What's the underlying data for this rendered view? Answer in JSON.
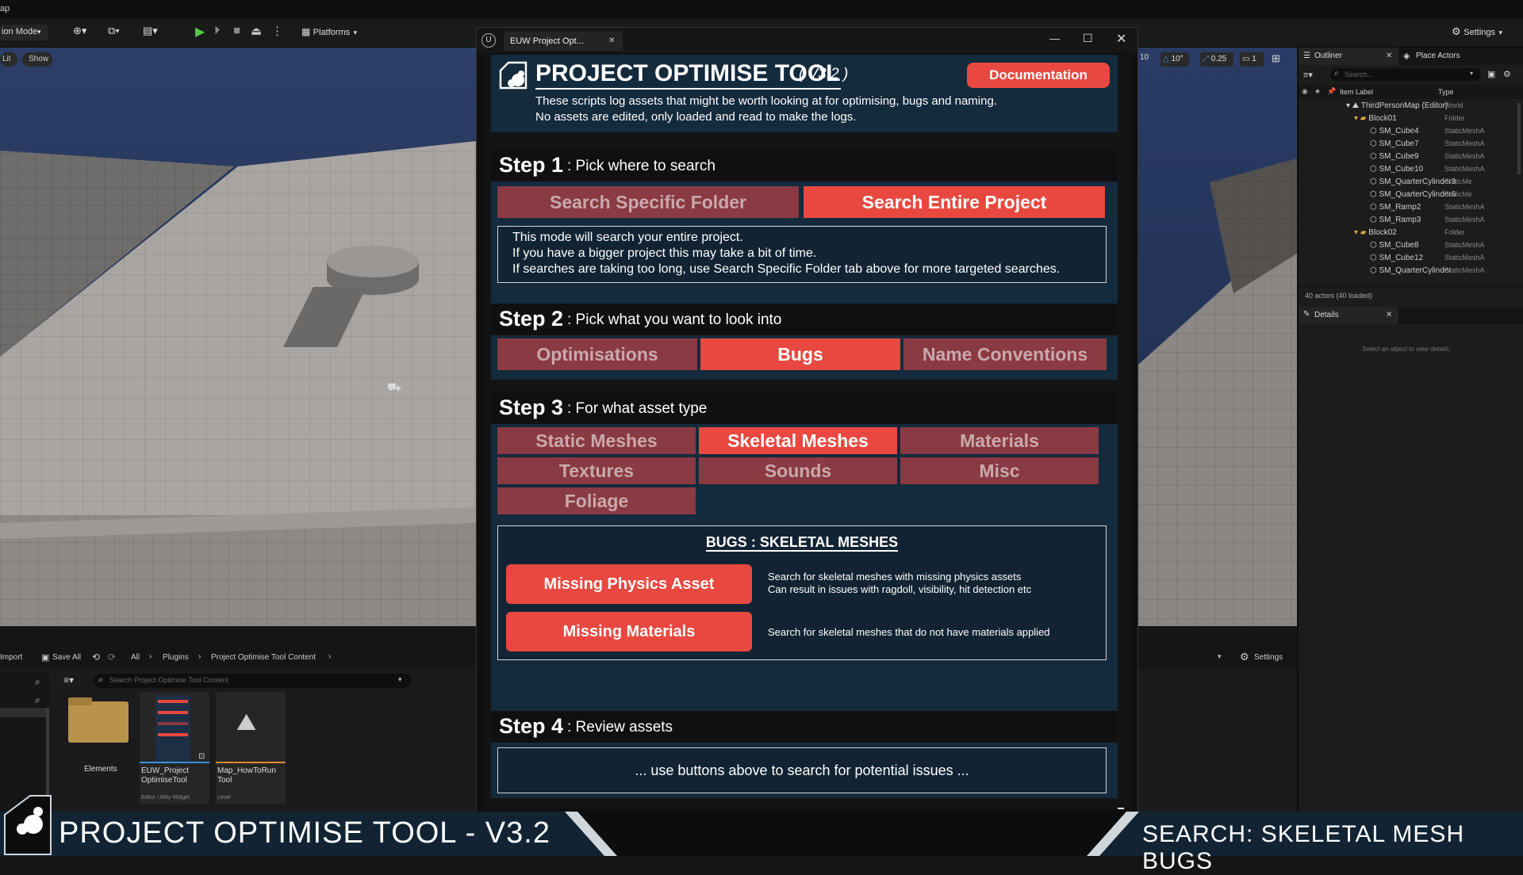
{
  "editor": {
    "top_partial": "ap",
    "mode_label": "ion Mode",
    "platforms_label": "Platforms",
    "settings_label": "Settings",
    "viewport": {
      "lit_label": "Lit",
      "show_label": "Show",
      "snap_values": [
        "10",
        "10°",
        "0.25",
        "1"
      ]
    },
    "content_browser": {
      "import_label": "Import",
      "save_all_label": "Save All",
      "crumbs": [
        "All",
        "Plugins",
        "Project Optimise Tool Content"
      ],
      "search_placeholder": "Search Project Optimise Tool Content",
      "settings_label": "Settings",
      "assets": [
        {
          "name": "Elements",
          "type": ""
        },
        {
          "name": "EUW_Project OptimiseTool",
          "type": "Editor Utility Widget"
        },
        {
          "name": "Map_HowToRun Tool",
          "type": "Level"
        }
      ]
    },
    "outliner": {
      "tab_outliner": "Outliner",
      "tab_place": "Place Actors",
      "search_placeholder": "Search...",
      "col_label": "Item Label",
      "col_type": "Type",
      "rows": [
        {
          "label": "ThirdPersonMap (Editor)",
          "type": "World"
        },
        {
          "label": "Block01",
          "type": "Folder"
        },
        {
          "label": "SM_Cube4",
          "type": "StaticMeshA"
        },
        {
          "label": "SM_Cube7",
          "type": "StaticMeshA"
        },
        {
          "label": "SM_Cube9",
          "type": "StaticMeshA"
        },
        {
          "label": "SM_Cube10",
          "type": "StaticMeshA"
        },
        {
          "label": "SM_QuarterCylinder3",
          "type": "StaticMeshA"
        },
        {
          "label": "SM_QuarterCylinder6",
          "type": "StaticMeshA"
        },
        {
          "label": "SM_Ramp2",
          "type": "StaticMeshA"
        },
        {
          "label": "SM_Ramp3",
          "type": "StaticMeshA"
        },
        {
          "label": "Block02",
          "type": "Folder"
        },
        {
          "label": "SM_Cube8",
          "type": "StaticMeshA"
        },
        {
          "label": "SM_Cube12",
          "type": "StaticMeshA"
        },
        {
          "label": "SM_QuarterCylinder",
          "type": "StaticMeshA"
        }
      ],
      "count": "40 actors (40 loaded)",
      "details_tab": "Details",
      "details_empty": "Select an object to view details."
    }
  },
  "dialog": {
    "tab_title": "EUW Project Opt...",
    "header": {
      "title": "PROJECT OPTIMISE TOOL",
      "version": "( V3.2 )",
      "doc_button": "Documentation",
      "desc1": "These scripts log assets that might be worth looking at for optimising, bugs and naming.",
      "desc2": "No assets are edited, only loaded and read to make the logs."
    },
    "step1": {
      "num": "Step 1",
      "label": ": Pick where to search",
      "btn_folder": "Search Specific Folder",
      "btn_entire": "Search Entire Project",
      "info1": "This mode will search your entire project.",
      "info2": "If you have a bigger project this may take a bit of time.",
      "info3": "If searches are taking too long, use Search Specific Folder tab above for more targeted searches."
    },
    "step2": {
      "num": "Step 2",
      "label": ": Pick what you want to look into",
      "opts": [
        "Optimisations",
        "Bugs",
        "Name Conventions"
      ]
    },
    "step3": {
      "num": "Step 3",
      "label": ": For what asset type",
      "types": [
        "Static Meshes",
        "Skeletal Meshes",
        "Materials",
        "Textures",
        "Sounds",
        "Misc",
        "Foliage"
      ],
      "section_title": "BUGS : SKELETAL MESHES",
      "btn_physics": "Missing Physics Asset",
      "physics_desc1": "Search for skeletal meshes with missing physics assets",
      "physics_desc2": "Can result in issues with ragdoll, visibility, hit detection etc",
      "btn_materials": "Missing Materials",
      "materials_desc": "Search for skeletal meshes that do not have materials applied"
    },
    "step4": {
      "num": "Step 4",
      "label": ": Review assets",
      "placeholder": "... use buttons above to search for potential issues ..."
    }
  },
  "banner": {
    "left": "PROJECT OPTIMISE TOOL  -  V3.2",
    "right": "SEARCH: SKELETAL MESH BUGS"
  },
  "colors": {
    "accent": "#e8483f",
    "inactive": "#8a3a42",
    "panel": "#142a3d"
  }
}
